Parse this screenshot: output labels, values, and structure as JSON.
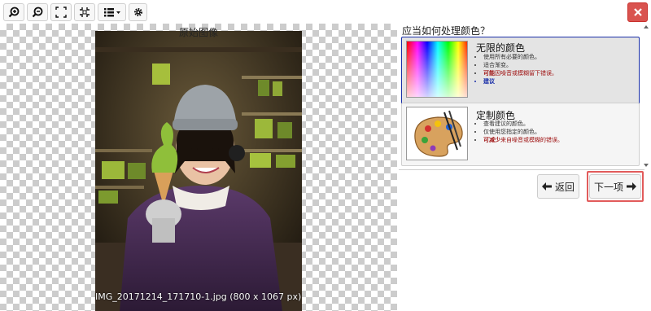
{
  "toolbar": {
    "buttons": [
      {
        "icon": "zoom-in-icon"
      },
      {
        "icon": "zoom-out-icon"
      },
      {
        "icon": "fit-screen-icon"
      },
      {
        "icon": "actual-size-icon"
      },
      {
        "icon": "list-dropdown-icon"
      },
      {
        "icon": "gear-icon"
      }
    ],
    "close_icon": "close-icon",
    "close_color": "#d9534f"
  },
  "image": {
    "title": "原始图像",
    "caption": "IMG_20171214_171710-1.jpg (800 x 1067 px)"
  },
  "panel": {
    "question": "应当如何处理颜色？",
    "options": [
      {
        "title": "无限的颜色",
        "selected": true,
        "items": [
          {
            "text": "使用所有必要的颜色。"
          },
          {
            "text": "适合渐变。"
          },
          {
            "bold": "可能",
            "text": "因噪音或模糊留下错误。"
          },
          {
            "text": "建议"
          }
        ]
      },
      {
        "title": "定制颜色",
        "selected": false,
        "items": [
          {
            "text": "查看建议的颜色。"
          },
          {
            "text": "仅使用您指定的颜色。"
          },
          {
            "bold": "可减少",
            "text": "来自噪音或模糊的错误。"
          }
        ]
      }
    ],
    "back_label": "返回",
    "next_label": "下一项",
    "accent_color": "#1a2fa8",
    "highlight_color": "#e25b5b"
  }
}
